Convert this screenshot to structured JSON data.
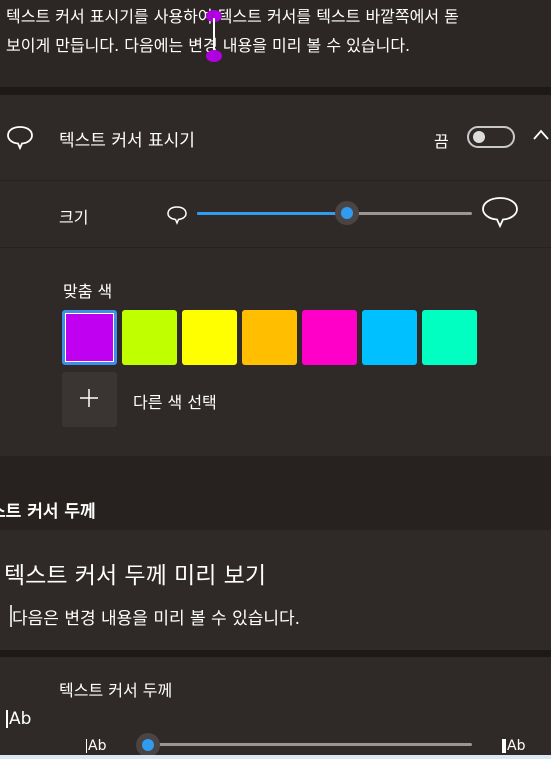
{
  "top_preview": {
    "text": "텍스트 커서 표시기를 사용하여 텍스트 커서를 텍스트 바깥쪽에서 돋\n보이게 만듭니다. 다음에는 변경 내용을 미리 볼 수 있습니다."
  },
  "indicator_header": {
    "title": "텍스트 커서 표시기",
    "toggle_state_label": "끔",
    "toggle_on": false
  },
  "size": {
    "label": "크기",
    "value_fraction": 0.5
  },
  "colors": {
    "title": "맞춤 색",
    "swatches": [
      "#c000f0",
      "#c0ff00",
      "#ffff00",
      "#ffbe00",
      "#ff00c8",
      "#00c0ff",
      "#00ffc0"
    ],
    "selected_index": 0,
    "add_label": "다른 색 선택"
  },
  "thickness": {
    "section_heading": "스트 커서 두께",
    "preview_title": "텍스트 커서 두께 미리 보기",
    "preview_text": "다음은 변경 내용을 미리 볼 수 있습니다.",
    "label": "텍스트 커서 두께",
    "icon_text": "Ab",
    "value_fraction": 0.0
  },
  "accent_color": "#2f9cf0"
}
